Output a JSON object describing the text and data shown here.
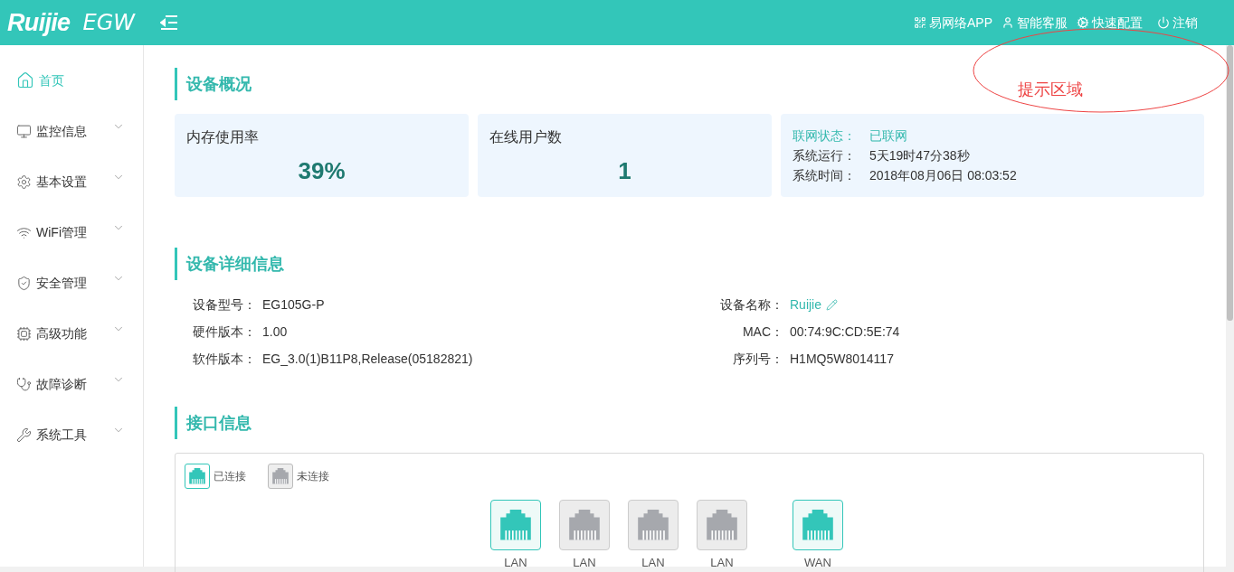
{
  "header": {
    "logo": "Ruijie",
    "product": "EGW",
    "links": [
      {
        "label": "易网络APP"
      },
      {
        "label": "智能客服"
      },
      {
        "label": "快速配置"
      },
      {
        "label": "注销"
      }
    ]
  },
  "annotation": {
    "label": "提示区域"
  },
  "sidebar": {
    "items": [
      {
        "label": "首页",
        "selected": true,
        "expandable": false
      },
      {
        "label": "监控信息",
        "selected": false,
        "expandable": true
      },
      {
        "label": "基本设置",
        "selected": false,
        "expandable": true
      },
      {
        "label": "WiFi管理",
        "selected": false,
        "expandable": true
      },
      {
        "label": "安全管理",
        "selected": false,
        "expandable": true
      },
      {
        "label": "高级功能",
        "selected": false,
        "expandable": true
      },
      {
        "label": "故障诊断",
        "selected": false,
        "expandable": true
      },
      {
        "label": "系统工具",
        "selected": false,
        "expandable": true
      }
    ]
  },
  "overview": {
    "title": "设备概况",
    "cards": [
      {
        "label": "内存使用率",
        "value": "39%"
      },
      {
        "label": "在线用户数",
        "value": "1"
      }
    ],
    "status": [
      {
        "label": "联网状态：",
        "value": "已联网",
        "highlight": true
      },
      {
        "label": "系统运行：",
        "value": "5天19时47分38秒",
        "highlight": false
      },
      {
        "label": "系统时间：",
        "value": "2018年08月06日 08:03:52",
        "highlight": false
      }
    ]
  },
  "details": {
    "title": "设备详细信息",
    "left": [
      {
        "label": "设备型号：",
        "value": "EG105G-P"
      },
      {
        "label": "硬件版本：",
        "value": "1.00"
      },
      {
        "label": "软件版本：",
        "value": "EG_3.0(1)B11P8,Release(05182821)"
      }
    ],
    "right": [
      {
        "label": "设备名称：",
        "value": "Ruijie",
        "editable": true
      },
      {
        "label": "MAC：",
        "value": "00:74:9C:CD:5E:74",
        "editable": false
      },
      {
        "label": "序列号：",
        "value": "H1MQ5W8014117",
        "editable": false
      }
    ]
  },
  "interfaces": {
    "title": "接口信息",
    "legend": [
      {
        "label": "已连接",
        "connected": true
      },
      {
        "label": "未连接",
        "connected": false
      }
    ],
    "ports": [
      {
        "kind": "lan",
        "label": "LAN",
        "connected": true
      },
      {
        "kind": "lan",
        "label": "LAN",
        "connected": false
      },
      {
        "kind": "lan",
        "label": "LAN",
        "connected": false
      },
      {
        "kind": "lan",
        "label": "LAN",
        "connected": false
      },
      {
        "kind": "wan",
        "label": "WAN",
        "connected": true
      }
    ]
  }
}
